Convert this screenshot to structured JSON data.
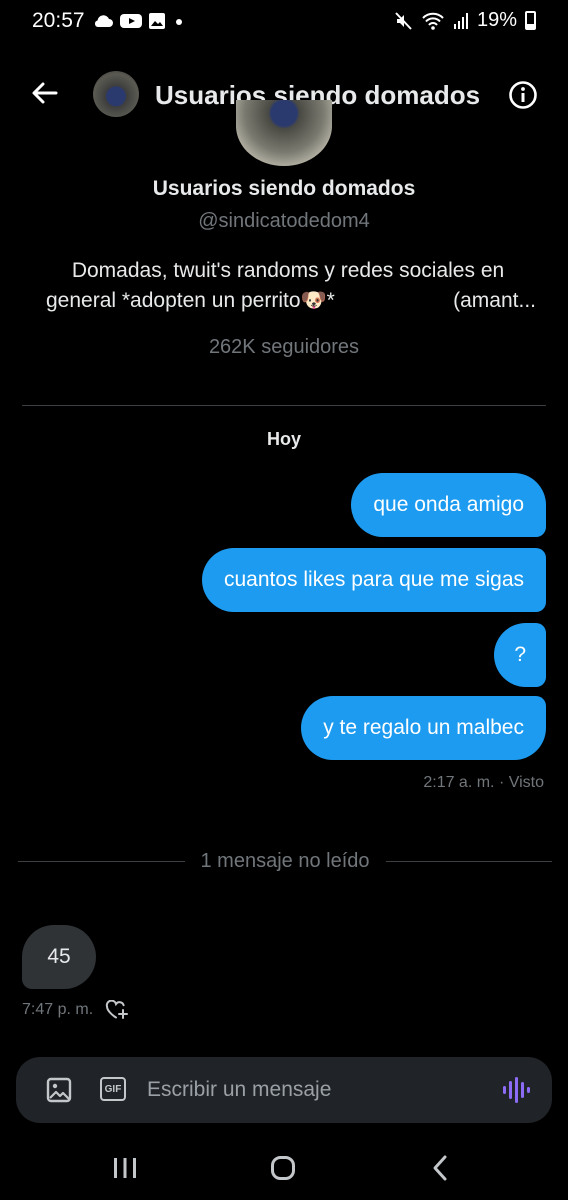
{
  "status_bar": {
    "time": "20:57",
    "battery": "19%",
    "left_icons": [
      "cloud-icon",
      "youtube-icon",
      "gallery-icon",
      "dot-icon"
    ],
    "right_icons": [
      "mute-icon",
      "wifi-icon",
      "signal-icon",
      "battery-icon"
    ]
  },
  "header": {
    "title": "Usuarios siendo domados",
    "back_icon": "arrow-left-icon",
    "info_icon": "info-icon"
  },
  "profile": {
    "name": "Usuarios siendo domados",
    "handle": "@sindicatodedom4",
    "bio_line1": "Domadas, twuit's randoms y redes sociales en",
    "bio_line2_a": "general   *adopten un perrito🐶*",
    "bio_line2_b": "(amant...",
    "followers": "262K seguidores"
  },
  "conversation": {
    "day_label": "Hoy",
    "sent_messages": [
      {
        "text": "que onda amigo"
      },
      {
        "text": "cuantos likes para que me sigas"
      },
      {
        "text": "?"
      },
      {
        "text": "y te regalo un malbec"
      }
    ],
    "sent_meta": "2:17 a. m. · Visto",
    "unread_divider": "1 mensaje no leído",
    "received_message": {
      "text": "45",
      "time": "7:47 p. m."
    }
  },
  "composer": {
    "placeholder": "Escribir un mensaje",
    "gif_label": "GIF",
    "accent": "#8c6cf6"
  },
  "colors": {
    "sent_bubble": "#1d9bf0",
    "received_bubble": "#2f3336",
    "background": "#000000",
    "muted_text": "#71767b"
  },
  "nav_bar": {
    "icons": [
      "recents-icon",
      "home-icon",
      "back-icon"
    ]
  }
}
